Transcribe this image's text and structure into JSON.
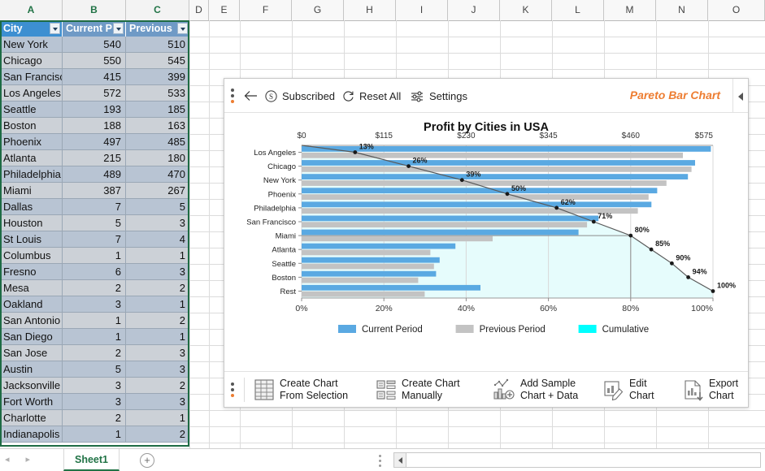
{
  "spreadsheet": {
    "column_headers": [
      "A",
      "B",
      "C",
      "D",
      "E",
      "F",
      "G",
      "H",
      "I",
      "J",
      "K",
      "L",
      "M",
      "N",
      "O"
    ],
    "table_headers": [
      "City",
      "Current P",
      "Previous"
    ],
    "rows": [
      {
        "city": "New York",
        "current": "540",
        "previous": "510"
      },
      {
        "city": "Chicago",
        "current": "550",
        "previous": "545"
      },
      {
        "city": "San Francisc",
        "current": "415",
        "previous": "399"
      },
      {
        "city": "Los Angeles",
        "current": "572",
        "previous": "533"
      },
      {
        "city": "Seattle",
        "current": "193",
        "previous": "185"
      },
      {
        "city": "Boston",
        "current": "188",
        "previous": "163"
      },
      {
        "city": "Phoenix",
        "current": "497",
        "previous": "485"
      },
      {
        "city": "Atlanta",
        "current": "215",
        "previous": "180"
      },
      {
        "city": "Philadelphia",
        "current": "489",
        "previous": "470"
      },
      {
        "city": "Miami",
        "current": "387",
        "previous": "267"
      },
      {
        "city": "Dallas",
        "current": "7",
        "previous": "5"
      },
      {
        "city": "Houston",
        "current": "5",
        "previous": "3"
      },
      {
        "city": "St Louis",
        "current": "7",
        "previous": "4"
      },
      {
        "city": "Columbus",
        "current": "1",
        "previous": "1"
      },
      {
        "city": "Fresno",
        "current": "6",
        "previous": "3"
      },
      {
        "city": "Mesa",
        "current": "2",
        "previous": "2"
      },
      {
        "city": "Oakland",
        "current": "3",
        "previous": "1"
      },
      {
        "city": "San Antonio",
        "current": "1",
        "previous": "2"
      },
      {
        "city": "San Diego",
        "current": "1",
        "previous": "1"
      },
      {
        "city": "San Jose",
        "current": "2",
        "previous": "3"
      },
      {
        "city": "Austin",
        "current": "5",
        "previous": "3"
      },
      {
        "city": "Jacksonville",
        "current": "3",
        "previous": "2"
      },
      {
        "city": "Fort Worth",
        "current": "3",
        "previous": "3"
      },
      {
        "city": "Charlotte",
        "current": "2",
        "previous": "1"
      },
      {
        "city": "Indianapolis",
        "current": "1",
        "previous": "2"
      }
    ],
    "status_bar": {
      "sheet_tab": "Sheet1",
      "add_sheet": "+",
      "prev_arrow": "◂",
      "next_arrow": "▸"
    }
  },
  "panel": {
    "toolbar": {
      "back": "",
      "subscribed": "Subscribed",
      "reset_all": "Reset All",
      "settings": "Settings",
      "brand": "Pareto Bar Chart"
    },
    "actions": [
      {
        "line1": "Create Chart",
        "line2": "From Selection",
        "icon": "table-grid-icon"
      },
      {
        "line1": "Create Chart",
        "line2": "Manually",
        "icon": "form-layout-icon"
      },
      {
        "line1": "Add Sample",
        "line2": "Chart + Data",
        "icon": "sample-chart-icon"
      },
      {
        "line1": "Edit",
        "line2": "Chart",
        "icon": "edit-chart-icon"
      },
      {
        "line1": "Export",
        "line2": "Chart",
        "icon": "export-chart-icon"
      }
    ]
  },
  "colors": {
    "current": "#5aa9e2",
    "previous": "#c3c3c3",
    "cumulative": "#00ffff",
    "cumulative_fill": "#e6fcfc",
    "line": "#595959",
    "brand": "#ed7d31",
    "excel_green": "#217346"
  },
  "chart_data": {
    "type": "bar",
    "title": "Profit by Cities in USA",
    "xlabel": "",
    "ylabel": "",
    "categories": [
      "Los Angeles",
      "Chicago",
      "New York",
      "Phoenix",
      "Philadelphia",
      "San Francisco",
      "Miami",
      "Atlanta",
      "Seattle",
      "Boston",
      "Rest"
    ],
    "series": [
      {
        "name": "Current Period",
        "values": [
          572,
          550,
          540,
          497,
          489,
          415,
          387,
          215,
          193,
          188,
          250
        ]
      },
      {
        "name": "Previous Period",
        "values": [
          533,
          545,
          510,
          485,
          470,
          399,
          267,
          180,
          185,
          163,
          172
        ]
      }
    ],
    "cumulative": {
      "name": "Cumulative",
      "values": [
        13,
        26,
        39,
        50,
        62,
        71,
        80,
        85,
        90,
        94,
        100
      ],
      "labels": [
        "13%",
        "26%",
        "39%",
        "50%",
        "62%",
        "71%",
        "80%",
        "85%",
        "90%",
        "94%",
        "100%"
      ]
    },
    "top_axis": {
      "ticks": [
        "$0",
        "$115",
        "$230",
        "$345",
        "$460",
        "$575"
      ],
      "min": 0,
      "max": 575
    },
    "bottom_axis": {
      "ticks": [
        "0%",
        "20%",
        "40%",
        "60%",
        "80%",
        "100%"
      ],
      "min": 0,
      "max": 100
    },
    "threshold_percent": 80,
    "legend": [
      {
        "label": "Current Period",
        "color": "#5aa9e2"
      },
      {
        "label": "Previous Period",
        "color": "#c3c3c3"
      },
      {
        "label": "Cumulative",
        "color": "#00ffff"
      }
    ],
    "legend_position": "bottom",
    "grid": true
  }
}
